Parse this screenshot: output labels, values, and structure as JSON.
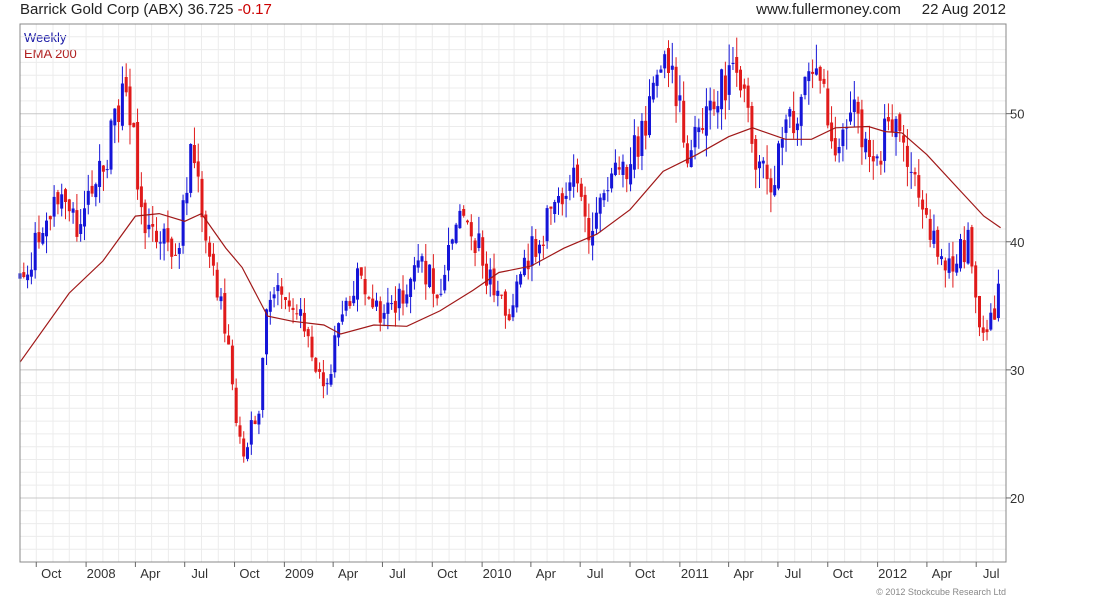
{
  "header": {
    "security": "Barrick Gold Corp (ABX)",
    "price": "36.725",
    "change": "-0.17",
    "source": "www.fullermoney.com",
    "date": "22 Aug 2012"
  },
  "legend": {
    "frequency": "Weekly",
    "overlay": "EMA 200"
  },
  "footer": {
    "copyright": "© 2012 Stockcube Research Ltd"
  },
  "colors": {
    "up": "#1515d8",
    "down": "#e01a1a",
    "ema": "#a01818",
    "grid": "#c8c8c8",
    "minor_grid": "#ececec"
  },
  "chart_data": {
    "type": "candlestick",
    "title": "Barrick Gold Corp (ABX)",
    "frequency": "Weekly",
    "ylim": [
      15,
      57
    ],
    "y_axis_side": "right",
    "y_ticks": [
      20,
      30,
      40,
      50
    ],
    "x_ticks": [
      "Oct",
      "2008",
      "Apr",
      "Jul",
      "Oct",
      "2009",
      "Apr",
      "Jul",
      "Oct",
      "2010",
      "Apr",
      "Jul",
      "Oct",
      "2011",
      "Apr",
      "Jul",
      "Oct",
      "2012",
      "Apr",
      "Jul"
    ],
    "x_tick_dates": [
      "2007-10",
      "2008-01",
      "2008-04",
      "2008-07",
      "2008-10",
      "2009-01",
      "2009-04",
      "2009-07",
      "2009-10",
      "2010-01",
      "2010-04",
      "2010-07",
      "2010-10",
      "2011-01",
      "2011-04",
      "2011-07",
      "2011-10",
      "2012-01",
      "2012-04",
      "2012-07"
    ],
    "date_range": [
      "2007-09",
      "2012-08"
    ],
    "grid": true,
    "close_path": [
      [
        "2007-09-01",
        37
      ],
      [
        "2007-11-01",
        43
      ],
      [
        "2007-12-15",
        41
      ],
      [
        "2008-02-15",
        48
      ],
      [
        "2008-03-15",
        52
      ],
      [
        "2008-04-15",
        42
      ],
      [
        "2008-05-15",
        40
      ],
      [
        "2008-06-15",
        39
      ],
      [
        "2008-07-15",
        47
      ],
      [
        "2008-08-15",
        40
      ],
      [
        "2008-09-15",
        33
      ],
      [
        "2008-10-15",
        23
      ],
      [
        "2008-11-15",
        27
      ],
      [
        "2008-12-01",
        37
      ],
      [
        "2009-01-01",
        35
      ],
      [
        "2009-02-15",
        33
      ],
      [
        "2009-03-15",
        28
      ],
      [
        "2009-04-15",
        34
      ],
      [
        "2009-05-15",
        37
      ],
      [
        "2009-06-15",
        35
      ],
      [
        "2009-07-15",
        34
      ],
      [
        "2009-08-15",
        37
      ],
      [
        "2009-09-15",
        38
      ],
      [
        "2009-10-15",
        36
      ],
      [
        "2009-11-15",
        42
      ],
      [
        "2009-12-15",
        41
      ],
      [
        "2010-01-15",
        37
      ],
      [
        "2010-02-15",
        34
      ],
      [
        "2010-03-15",
        38
      ],
      [
        "2010-04-15",
        40
      ],
      [
        "2010-05-15",
        43
      ],
      [
        "2010-06-15",
        45
      ],
      [
        "2010-07-15",
        41
      ],
      [
        "2010-08-15",
        44
      ],
      [
        "2010-09-15",
        46
      ],
      [
        "2010-10-15",
        47
      ],
      [
        "2010-11-15",
        53
      ],
      [
        "2010-12-15",
        53
      ],
      [
        "2011-01-15",
        47
      ],
      [
        "2011-02-15",
        49
      ],
      [
        "2011-03-15",
        52
      ],
      [
        "2011-04-15",
        54
      ],
      [
        "2011-05-15",
        47
      ],
      [
        "2011-06-15",
        45
      ],
      [
        "2011-07-15",
        48
      ],
      [
        "2011-08-15",
        52
      ],
      [
        "2011-09-15",
        54
      ],
      [
        "2011-10-15",
        48
      ],
      [
        "2011-11-15",
        51
      ],
      [
        "2011-12-15",
        46
      ],
      [
        "2012-01-15",
        48
      ],
      [
        "2012-02-15",
        48
      ],
      [
        "2012-03-15",
        44
      ],
      [
        "2012-04-15",
        40
      ],
      [
        "2012-05-15",
        38
      ],
      [
        "2012-06-15",
        40
      ],
      [
        "2012-07-01",
        35
      ],
      [
        "2012-07-15",
        32
      ],
      [
        "2012-08-01",
        34
      ],
      [
        "2012-08-15",
        36.725
      ]
    ],
    "series": [
      {
        "name": "EMA 200",
        "type": "line",
        "points": [
          [
            "2007-09-01",
            30.6
          ],
          [
            "2007-12-01",
            36
          ],
          [
            "2008-02-01",
            38.5
          ],
          [
            "2008-04-01",
            42
          ],
          [
            "2008-05-15",
            42.2
          ],
          [
            "2008-07-01",
            41.6
          ],
          [
            "2008-08-01",
            42.2
          ],
          [
            "2008-09-15",
            39.5
          ],
          [
            "2008-10-15",
            38
          ],
          [
            "2008-12-01",
            34.2
          ],
          [
            "2009-01-15",
            33.8
          ],
          [
            "2009-03-15",
            33.5
          ],
          [
            "2009-04-15",
            32.8
          ],
          [
            "2009-06-15",
            33.5
          ],
          [
            "2009-08-15",
            33.4
          ],
          [
            "2009-10-15",
            34.6
          ],
          [
            "2009-12-15",
            36.2
          ],
          [
            "2010-02-01",
            37.6
          ],
          [
            "2010-04-01",
            38.1
          ],
          [
            "2010-06-01",
            39.5
          ],
          [
            "2010-08-01",
            40.6
          ],
          [
            "2010-10-01",
            42.5
          ],
          [
            "2010-12-01",
            45.5
          ],
          [
            "2011-02-01",
            46.8
          ],
          [
            "2011-04-01",
            48.2
          ],
          [
            "2011-05-15",
            48.9
          ],
          [
            "2011-07-15",
            48
          ],
          [
            "2011-09-01",
            48
          ],
          [
            "2011-10-15",
            48.9
          ],
          [
            "2011-12-15",
            49
          ],
          [
            "2012-01-15",
            48.6
          ],
          [
            "2012-02-15",
            48.5
          ],
          [
            "2012-04-01",
            46.8
          ],
          [
            "2012-06-01",
            44
          ],
          [
            "2012-07-15",
            42
          ],
          [
            "2012-08-15",
            41.1
          ]
        ]
      }
    ]
  }
}
